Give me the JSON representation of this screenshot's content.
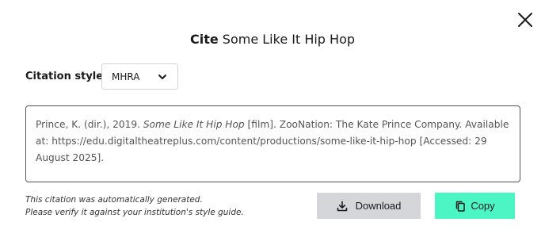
{
  "dialog": {
    "title_prefix": "Cite",
    "title_work": "Some Like It Hip Hop",
    "close_icon": "close-icon"
  },
  "citation_style": {
    "label": "Citation style:",
    "selected": "MHRA",
    "icon": "chevron-down-icon"
  },
  "citation": {
    "before_title": "Prince, K. (dir.), 2019. ",
    "title": "Some Like It Hip Hop",
    "after_title": " [film]. ZooNation: The Kate Prince Company. Available at: https://edu.digitaltheatreplus.com/content/productions/some-like-it-hip-hop [Accessed: 29 August 2025]."
  },
  "notice": {
    "line1": "This citation was automatically generated.",
    "line2": "Please verify it against your institution's style guide."
  },
  "actions": {
    "download_label": "Download",
    "download_icon": "download-icon",
    "copy_label": "Copy",
    "copy_icon": "copy-icon"
  },
  "colors": {
    "copy_button": "#4cf5c4",
    "download_button": "#d4d6da",
    "text": "#1a1a1a"
  }
}
